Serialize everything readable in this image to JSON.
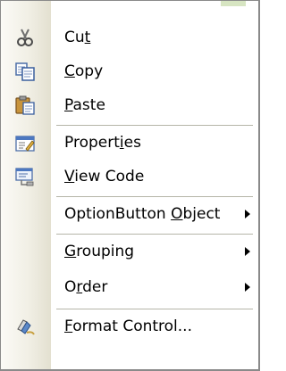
{
  "menu": {
    "items": [
      {
        "pre": "Cu",
        "key": "t",
        "post": "",
        "icon": "scissors-icon"
      },
      {
        "pre": "",
        "key": "C",
        "post": "opy",
        "icon": "copy-icon"
      },
      {
        "pre": "",
        "key": "P",
        "post": "aste",
        "icon": "paste-icon"
      },
      {
        "pre": "Propert",
        "key": "i",
        "post": "es",
        "icon": "properties-icon"
      },
      {
        "pre": "",
        "key": "V",
        "post": "iew Code",
        "icon": "view-code-icon"
      },
      {
        "pre": "OptionButton ",
        "key": "O",
        "post": "bject",
        "submenu": true
      },
      {
        "pre": "",
        "key": "G",
        "post": "rouping",
        "submenu": true
      },
      {
        "pre": "O",
        "key": "r",
        "post": "der",
        "submenu": true
      },
      {
        "pre": "",
        "key": "F",
        "post": "ormat Control...",
        "icon": "format-control-icon"
      }
    ]
  }
}
